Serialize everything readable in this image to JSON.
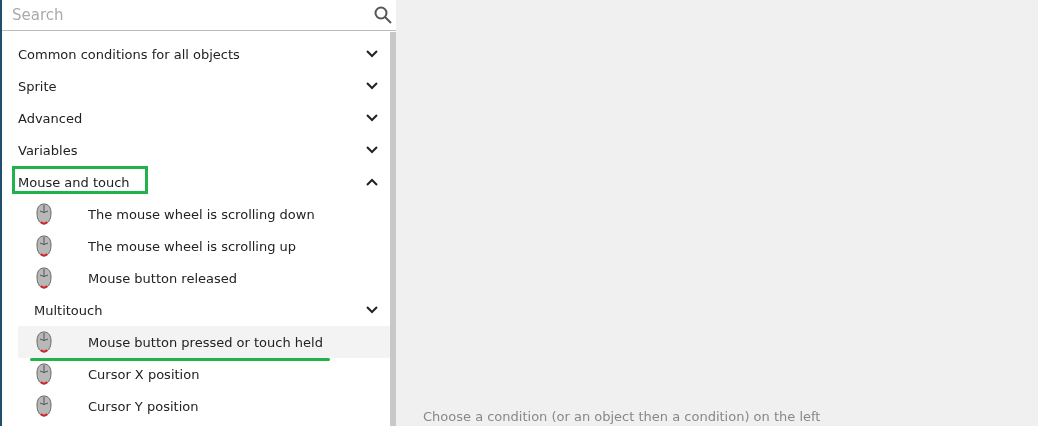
{
  "search": {
    "placeholder": "Search"
  },
  "groups": [
    {
      "label": "Common conditions for all objects",
      "expanded": false,
      "highlighted": false
    },
    {
      "label": "Sprite",
      "expanded": false,
      "highlighted": false
    },
    {
      "label": "Advanced",
      "expanded": false,
      "highlighted": false
    },
    {
      "label": "Variables",
      "expanded": false,
      "highlighted": false
    },
    {
      "label": "Mouse and touch",
      "expanded": true,
      "highlighted": true,
      "children": [
        {
          "kind": "condition",
          "label": "The mouse wheel is scrolling down",
          "selected": false,
          "underlined": false
        },
        {
          "kind": "condition",
          "label": "The mouse wheel is scrolling up",
          "selected": false,
          "underlined": false
        },
        {
          "kind": "condition",
          "label": "Mouse button released",
          "selected": false,
          "underlined": false
        },
        {
          "kind": "group",
          "label": "Multitouch",
          "expanded": false
        },
        {
          "kind": "condition",
          "label": "Mouse button pressed or touch held",
          "selected": true,
          "underlined": true
        },
        {
          "kind": "condition",
          "label": "Cursor X position",
          "selected": false,
          "underlined": false
        },
        {
          "kind": "condition",
          "label": "Cursor Y position",
          "selected": false,
          "underlined": false
        }
      ]
    }
  ],
  "hint": "Choose a condition (or an object then a condition) on the left"
}
